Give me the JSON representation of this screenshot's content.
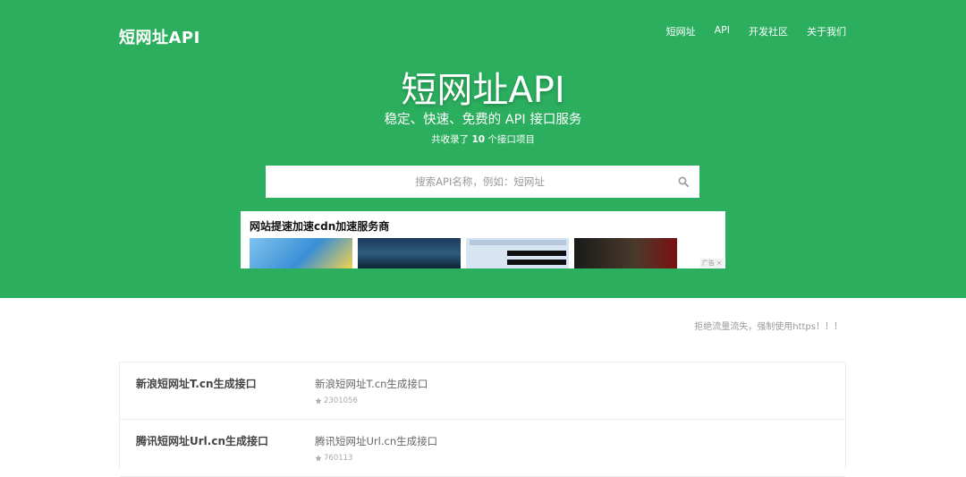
{
  "header": {
    "brand": "短网址API",
    "nav": [
      "短网址",
      "API",
      "开发社区",
      "关于我们"
    ]
  },
  "hero": {
    "title": "短网址API",
    "subtitle": "稳定、快速、免费的 API 接口服务",
    "count_prefix": "共收录了 ",
    "count": "10",
    "count_suffix": " 个接口项目"
  },
  "search": {
    "placeholder": "搜索API名称，例如：短网址",
    "icon": "search-icon"
  },
  "ad": {
    "title": "网站提速加速cdn加速服务商",
    "mark": "广告 ×"
  },
  "notice": "拒绝流量流失，强制使用https！！！",
  "items": [
    {
      "name": "新浪短网址T.cn生成接口",
      "desc": "新浪短网址T.cn生成接口",
      "stars": "2301056"
    },
    {
      "name": "腾讯短网址Url.cn生成接口",
      "desc": "腾讯短网址Url.cn生成接口",
      "stars": "760113"
    }
  ],
  "colors": {
    "hero_bg": "#2baf5f",
    "text_white": "#ffffff"
  }
}
